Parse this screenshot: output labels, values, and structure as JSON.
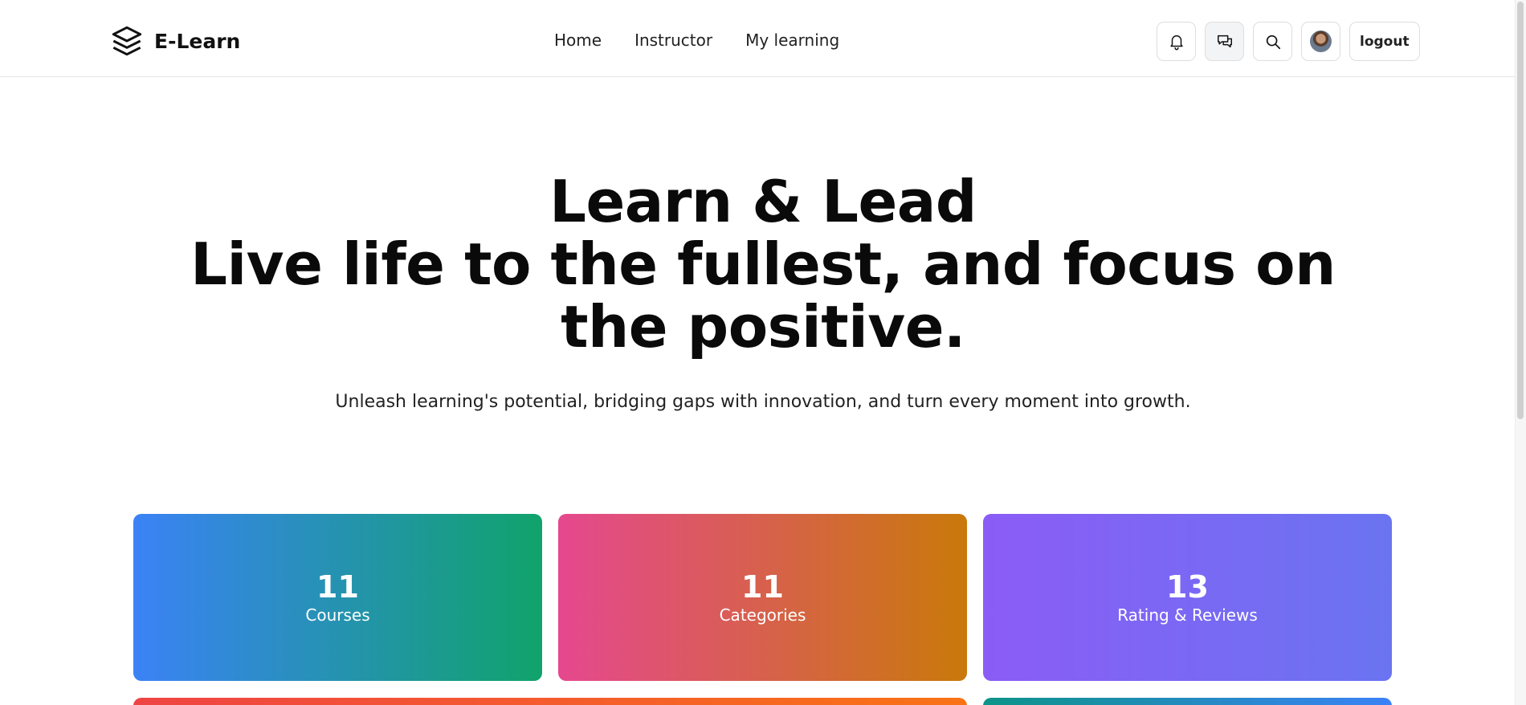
{
  "header": {
    "brand": "E-Learn",
    "nav": [
      {
        "label": "Home"
      },
      {
        "label": "Instructor"
      },
      {
        "label": "My learning"
      }
    ],
    "actions": {
      "notifications_icon": "bell-icon",
      "messages_icon": "chat-icon",
      "search_icon": "search-icon",
      "logout_label": "logout"
    }
  },
  "hero": {
    "title_line1": "Learn & Lead",
    "title_line2": "Live life to the fullest, and focus on the positive.",
    "subtitle": "Unleash learning's potential, bridging gaps with innovation, and turn every moment into growth."
  },
  "stats": [
    {
      "value": "11",
      "label": "Courses"
    },
    {
      "value": "11",
      "label": "Categories"
    },
    {
      "value": "13",
      "label": "Rating & Reviews"
    }
  ],
  "colors": {
    "courses_gradient": [
      "#3b82f6",
      "#10a36b"
    ],
    "categories_gradient": [
      "#e5488f",
      "#c9790a"
    ],
    "ratings_gradient": [
      "#8b5cf6",
      "#6a74f1"
    ]
  }
}
